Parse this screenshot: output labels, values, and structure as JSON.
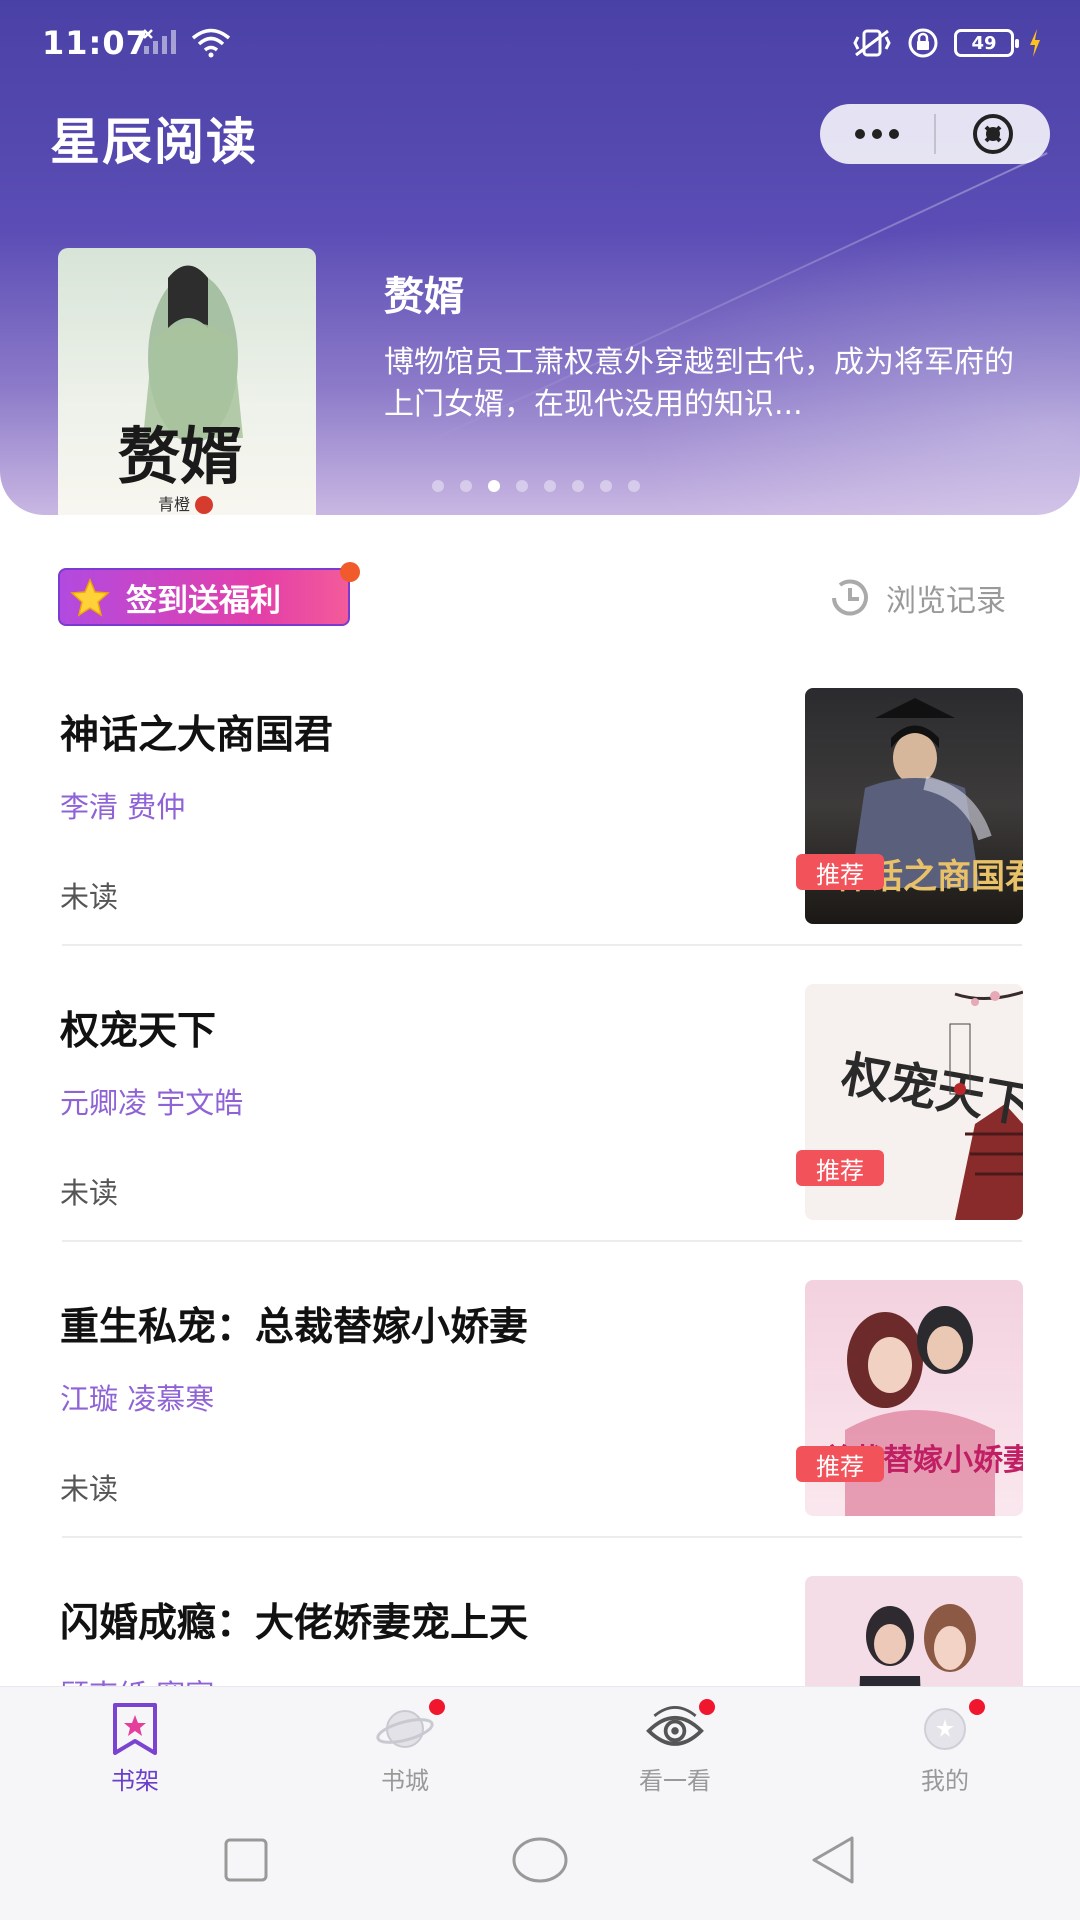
{
  "status_bar": {
    "time": "11:07",
    "battery": "49"
  },
  "header": {
    "title": "星辰阅读"
  },
  "banner": {
    "title": "赘婿",
    "description": "博物馆员工萧权意外穿越到古代，成为将军府的上门女婿，在现代没用的知识...",
    "cover_text": "赘婿",
    "cover_author": "青橙",
    "page_count": 8,
    "active_page": 3
  },
  "toolbar": {
    "signin_label": "签到送福利",
    "history_label": "浏览记录"
  },
  "books": [
    {
      "title": "神话之大商国君",
      "authors": "李清 费仲",
      "status": "未读",
      "tag": "推荐",
      "cover_text": "神话之商国君"
    },
    {
      "title": "权宠天下",
      "authors": "元卿凌 宇文皓",
      "status": "未读",
      "tag": "推荐",
      "cover_text": "权宠天下"
    },
    {
      "title": "重生私宠：总裁替嫁小娇妻",
      "authors": "江璇 凌慕寒",
      "status": "未读",
      "tag": "推荐",
      "cover_text": "总裁替嫁小娇妻"
    },
    {
      "title": "闪婚成瘾：大佬娇妻宠上天",
      "authors": "顾南纸 寒宴",
      "status": "未读",
      "tag": "",
      "cover_text": ""
    }
  ],
  "tabs": [
    {
      "label": "书架",
      "icon": "bookmark-star-icon",
      "active": true
    },
    {
      "label": "书城",
      "icon": "planet-icon",
      "active": false
    },
    {
      "label": "看一看",
      "icon": "eye-icon",
      "active": false
    },
    {
      "label": "我的",
      "icon": "profile-planet-icon",
      "active": false
    }
  ],
  "colors": {
    "header_gradient_top": "#4a41a6",
    "accent_purple": "#8f63d6",
    "tag_red": "#f2525a",
    "signin_gradient": "#e440a8"
  }
}
